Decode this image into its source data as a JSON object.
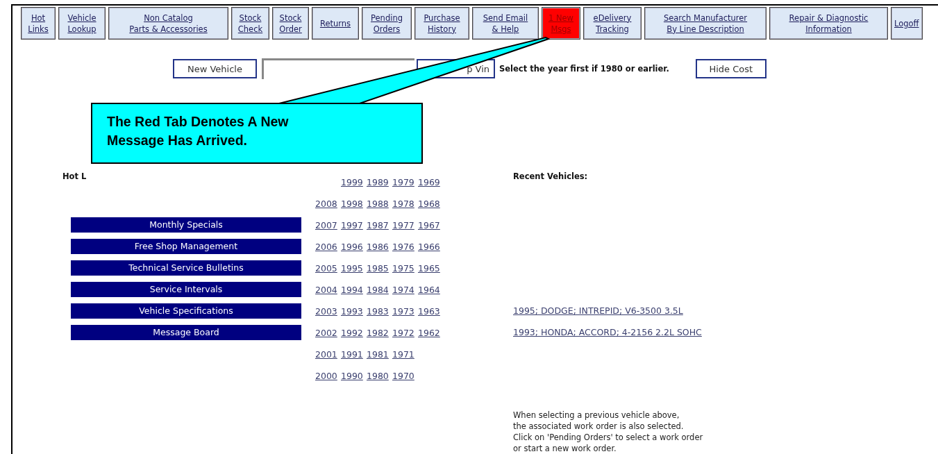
{
  "nav_tabs": [
    {
      "lines": [
        "Hot",
        "Links"
      ],
      "new_message": false
    },
    {
      "lines": [
        "Vehicle",
        "Lookup"
      ],
      "new_message": false
    },
    {
      "lines": [
        "Non Catalog",
        "Parts & Accessories"
      ],
      "new_message": false
    },
    {
      "lines": [
        "Stock",
        "Check"
      ],
      "new_message": false
    },
    {
      "lines": [
        "Stock",
        "Order"
      ],
      "new_message": false
    },
    {
      "lines": [
        "Returns"
      ],
      "new_message": false
    },
    {
      "lines": [
        "Pending",
        "Orders"
      ],
      "new_message": false
    },
    {
      "lines": [
        "Purchase",
        "History"
      ],
      "new_message": false
    },
    {
      "lines": [
        "Send Email",
        "& Help"
      ],
      "new_message": false
    },
    {
      "lines": [
        "1 New",
        "Msgs"
      ],
      "new_message": true
    },
    {
      "lines": [
        "eDelivery",
        "Tracking"
      ],
      "new_message": false
    },
    {
      "lines": [
        "Search Manufacturer",
        "By Line Description"
      ],
      "new_message": false
    },
    {
      "lines": [
        "Repair & Diagnostic",
        "Information"
      ],
      "new_message": false
    },
    {
      "lines": [
        "Logoff"
      ],
      "new_message": false
    }
  ],
  "vehicle_bar": {
    "new_vehicle_button": "New Vehicle",
    "lookup_button_parts": [
      "p Vin"
    ],
    "hint": "Select the year first if 1980 or earlier.",
    "hide_cost_button": "Hide Cost"
  },
  "hot_links": {
    "heading": "Hot L",
    "items": [
      "Monthly Specials",
      "Free Shop Management",
      "Technical Service Bulletins",
      "Service Intervals",
      "Vehicle Specifications",
      "Message Board"
    ]
  },
  "year_columns": [
    [
      "2008",
      "2007",
      "2006",
      "2005",
      "2004",
      "2003",
      "2002",
      "2001",
      "2000"
    ],
    [
      "1999",
      "1998",
      "1997",
      "1996",
      "1995",
      "1994",
      "1993",
      "1992",
      "1991",
      "1990"
    ],
    [
      "1989",
      "1988",
      "1987",
      "1986",
      "1985",
      "1984",
      "1983",
      "1982",
      "1981",
      "1980"
    ],
    [
      "1979",
      "1978",
      "1977",
      "1976",
      "1975",
      "1974",
      "1973",
      "1972",
      "1971",
      "1970"
    ],
    [
      "1969",
      "1968",
      "1967",
      "1966",
      "1965",
      "1964",
      "1963",
      "1962"
    ]
  ],
  "recent_vehicles": {
    "heading": "Recent Vehicles:",
    "items": [
      "1995; DODGE; INTREPID; V6-3500 3.5L",
      "1993; HONDA; ACCORD; 4-2156 2.2L SOHC"
    ]
  },
  "note": [
    "When selecting a previous vehicle above,",
    "the associated work order is also selected.",
    "Click on 'Pending Orders' to select a work order",
    "or start a new work order."
  ],
  "callout": {
    "text": "The Red Tab Denotes A New Message Has Arrived."
  }
}
